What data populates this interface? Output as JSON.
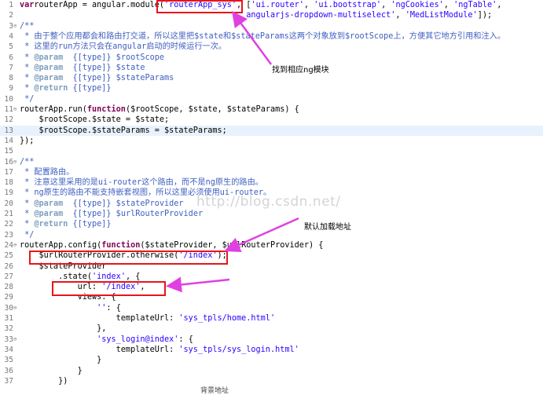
{
  "lines": [
    {
      "n": "1",
      "fold": "",
      "segs": [
        [
          "kw",
          "var"
        ],
        [
          "",
          "routerApp = angular."
        ],
        [
          "",
          "module("
        ],
        [
          "str",
          "'routerApp_sys'"
        ],
        [
          "",
          ", ["
        ],
        [
          "str",
          "'ui.router'"
        ],
        [
          "",
          ", "
        ],
        [
          "str",
          "'ui.bootstrap'"
        ],
        [
          "",
          ", "
        ],
        [
          "str",
          "'ngCookies'"
        ],
        [
          "",
          ", "
        ],
        [
          "str",
          "'ngTable'"
        ],
        [
          "",
          ","
        ]
      ]
    },
    {
      "n": "2",
      "fold": "",
      "segs": [
        [
          "",
          "                                               "
        ],
        [
          "str",
          "angularjs-dropdown-multiselect'"
        ],
        [
          "",
          ", "
        ],
        [
          "str",
          "'MedListModule'"
        ],
        [
          "",
          "]);"
        ]
      ]
    },
    {
      "n": "3",
      "fold": "⊖",
      "segs": [
        [
          "cmt",
          "/**"
        ]
      ]
    },
    {
      "n": "4",
      "fold": "",
      "segs": [
        [
          "cmt",
          " * 由于整个应用都会和路由打交道，所以这里把$state和$stateParams这两个对象放到$rootScope上，方便其它地方引用和注入。"
        ]
      ]
    },
    {
      "n": "5",
      "fold": "",
      "segs": [
        [
          "cmt",
          " * 这里的run方法只会在angular启动的时候运行一次。"
        ]
      ]
    },
    {
      "n": "6",
      "fold": "",
      "segs": [
        [
          "cmt",
          " * "
        ],
        [
          "tag",
          "@param"
        ],
        [
          "cmt",
          "  {[type]} $rootScope"
        ]
      ]
    },
    {
      "n": "7",
      "fold": "",
      "segs": [
        [
          "cmt",
          " * "
        ],
        [
          "tag",
          "@param"
        ],
        [
          "cmt",
          "  {[type]} $state"
        ]
      ]
    },
    {
      "n": "8",
      "fold": "",
      "segs": [
        [
          "cmt",
          " * "
        ],
        [
          "tag",
          "@param"
        ],
        [
          "cmt",
          "  {[type]} $stateParams"
        ]
      ]
    },
    {
      "n": "9",
      "fold": "",
      "segs": [
        [
          "cmt",
          " * "
        ],
        [
          "tag",
          "@return"
        ],
        [
          "cmt",
          " {[type]}"
        ]
      ]
    },
    {
      "n": "10",
      "fold": "",
      "segs": [
        [
          "cmt",
          " */"
        ]
      ]
    },
    {
      "n": "11",
      "fold": "⊖",
      "segs": [
        [
          "",
          "routerApp.run("
        ],
        [
          "kw",
          "function"
        ],
        [
          "",
          "($rootScope, $state, $stateParams) {"
        ]
      ]
    },
    {
      "n": "12",
      "fold": "",
      "segs": [
        [
          "",
          "    $rootScope.$state = $state;"
        ]
      ]
    },
    {
      "n": "13",
      "fold": "",
      "segs": [
        [
          "",
          "    $rootScope.$stateParams = $stateParams;"
        ]
      ]
    },
    {
      "n": "14",
      "fold": "",
      "segs": [
        [
          "",
          "});"
        ]
      ]
    },
    {
      "n": "15",
      "fold": "",
      "segs": [
        [
          "",
          ""
        ]
      ]
    },
    {
      "n": "16",
      "fold": "⊖",
      "segs": [
        [
          "cmt",
          "/**"
        ]
      ]
    },
    {
      "n": "17",
      "fold": "",
      "segs": [
        [
          "cmt",
          " * 配置路由。"
        ]
      ]
    },
    {
      "n": "18",
      "fold": "",
      "segs": [
        [
          "cmt",
          " * 注意这里采用的是ui-router这个路由，而不是ng原生的路由。"
        ]
      ]
    },
    {
      "n": "19",
      "fold": "",
      "segs": [
        [
          "cmt",
          " * ng原生的路由不能支持嵌套视图，所以这里必须使用ui-router。"
        ]
      ]
    },
    {
      "n": "20",
      "fold": "",
      "segs": [
        [
          "cmt",
          " * "
        ],
        [
          "tag",
          "@param"
        ],
        [
          "cmt",
          "  {[type]} $stateProvider"
        ]
      ]
    },
    {
      "n": "21",
      "fold": "",
      "segs": [
        [
          "cmt",
          " * "
        ],
        [
          "tag",
          "@param"
        ],
        [
          "cmt",
          "  {[type]} $urlRouterProvider"
        ]
      ]
    },
    {
      "n": "22",
      "fold": "",
      "segs": [
        [
          "cmt",
          " * "
        ],
        [
          "tag",
          "@return"
        ],
        [
          "cmt",
          " {[type]}"
        ]
      ]
    },
    {
      "n": "23",
      "fold": "",
      "segs": [
        [
          "cmt",
          " */"
        ]
      ]
    },
    {
      "n": "24",
      "fold": "⊖",
      "segs": [
        [
          "",
          "routerApp.config("
        ],
        [
          "kw",
          "function"
        ],
        [
          "",
          "($stateProvider, $urlRouterProvider) {"
        ]
      ]
    },
    {
      "n": "25",
      "fold": "",
      "segs": [
        [
          "",
          "    $urlRouterProvider.otherwise("
        ],
        [
          "str",
          "'/index'"
        ],
        [
          "",
          ");"
        ]
      ]
    },
    {
      "n": "26",
      "fold": "",
      "segs": [
        [
          "",
          "    $stateProvider"
        ]
      ]
    },
    {
      "n": "27",
      "fold": "",
      "segs": [
        [
          "",
          "        .state("
        ],
        [
          "str",
          "'index'"
        ],
        [
          "",
          ", {"
        ]
      ]
    },
    {
      "n": "28",
      "fold": "",
      "segs": [
        [
          "",
          "            url: "
        ],
        [
          "str",
          "'/index'"
        ],
        [
          "",
          ","
        ]
      ]
    },
    {
      "n": "29",
      "fold": "",
      "segs": [
        [
          "",
          "            views: {"
        ]
      ]
    },
    {
      "n": "30",
      "fold": "⊖",
      "segs": [
        [
          "",
          "                "
        ],
        [
          "str",
          "''"
        ],
        [
          "",
          ": {"
        ]
      ]
    },
    {
      "n": "31",
      "fold": "",
      "segs": [
        [
          "",
          "                    templateUrl: "
        ],
        [
          "str",
          "'sys_tpls/home.html'"
        ]
      ]
    },
    {
      "n": "32",
      "fold": "",
      "segs": [
        [
          "",
          "                },"
        ]
      ]
    },
    {
      "n": "33",
      "fold": "⊖",
      "segs": [
        [
          "",
          "                "
        ],
        [
          "str",
          "'sys_login@index'"
        ],
        [
          "",
          ": {"
        ]
      ]
    },
    {
      "n": "34",
      "fold": "",
      "segs": [
        [
          "",
          "                    templateUrl: "
        ],
        [
          "str",
          "'sys_tpls/sys_login.html'"
        ]
      ]
    },
    {
      "n": "35",
      "fold": "",
      "segs": [
        [
          "",
          "                }"
        ]
      ]
    },
    {
      "n": "36",
      "fold": "",
      "segs": [
        [
          "",
          "            }"
        ]
      ]
    },
    {
      "n": "37",
      "fold": "",
      "segs": [
        [
          "",
          "        })"
        ]
      ]
    }
  ],
  "current_line": "13",
  "annotations": {
    "find_module": "找到相应ng模块",
    "default_url": "默认加载地址",
    "bottom_partial": "背景地址"
  },
  "watermark": "http://blog.csdn.net/",
  "colors": {
    "keyword": "#7f0055",
    "string": "#2a00ff",
    "comment": "#3f5fbf",
    "highlight_box": "#e8151b",
    "arrow": "#e040e0"
  }
}
